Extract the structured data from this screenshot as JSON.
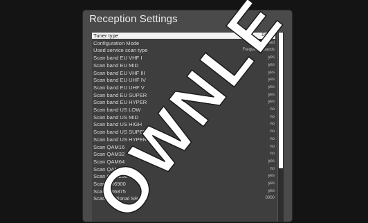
{
  "screen": {
    "title": "Reception Settings"
  },
  "list": {
    "items": [
      {
        "label": "Tuner type",
        "value": "DVB-C"
      },
      {
        "label": "Configuration Mode",
        "value": "enabled"
      },
      {
        "label": "Used service scan type",
        "value": "Frequency bands"
      },
      {
        "label": "Scan band EU VHF I",
        "value": "yes"
      },
      {
        "label": "Scan band EU MID",
        "value": "yes"
      },
      {
        "label": "Scan band EU VHF III",
        "value": "yes"
      },
      {
        "label": "Scan band EU UHF IV",
        "value": "yes"
      },
      {
        "label": "Scan band EU UHF V",
        "value": "yes"
      },
      {
        "label": "Scan band EU SUPER",
        "value": "yes"
      },
      {
        "label": "Scan band EU HYPER",
        "value": "yes"
      },
      {
        "label": "Scan band US LOW",
        "value": "no"
      },
      {
        "label": "Scan band US MID",
        "value": "no"
      },
      {
        "label": "Scan band US HIGH",
        "value": "no"
      },
      {
        "label": "Scan band US SUPER",
        "value": "no"
      },
      {
        "label": "Scan band US HYPER",
        "value": "no"
      },
      {
        "label": "Scan QAM16",
        "value": "no"
      },
      {
        "label": "Scan QAM32",
        "value": "no"
      },
      {
        "label": "Scan QAM64",
        "value": "yes"
      },
      {
        "label": "Scan QAM128",
        "value": "no"
      },
      {
        "label": "Scan QAM256",
        "value": "yes"
      },
      {
        "label": "Scan SR6900",
        "value": "yes"
      },
      {
        "label": "Scan SR6875",
        "value": "yes"
      },
      {
        "label": "Scan additional SR",
        "value": "0000"
      }
    ],
    "selected_index": 0,
    "scroll_position_fraction": 0.0,
    "scroll_visible_fraction": 0.72
  },
  "watermark": {
    "text": "OWNLE"
  },
  "colors": {
    "panel": "#4a4a4a",
    "list_background": "#3e3e3e",
    "selection": "#f4f4f4",
    "background": "#141414"
  }
}
